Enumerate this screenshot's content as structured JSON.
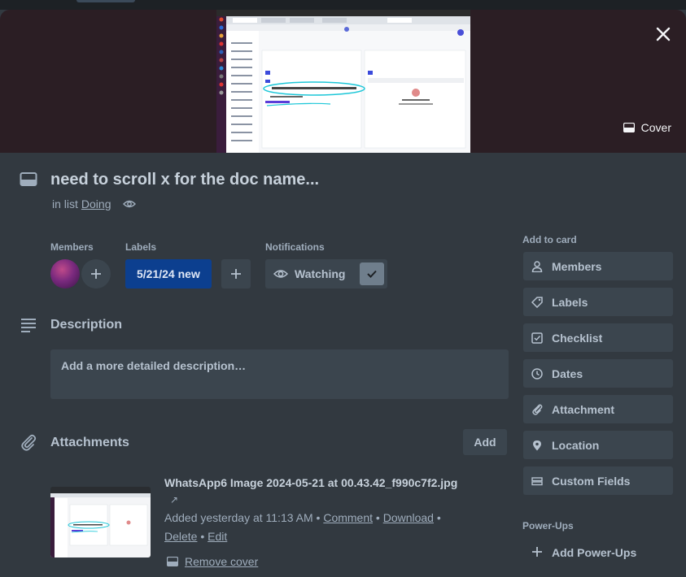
{
  "card": {
    "title": "need to scroll x for the doc name...",
    "in_list_prefix": "in list",
    "list_name": "Doing"
  },
  "cover": {
    "button_label": "Cover"
  },
  "members": {
    "label": "Members"
  },
  "labels": {
    "label": "Labels",
    "chip": "5/21/24 new",
    "chip_color": "#0c3f8f"
  },
  "notifications": {
    "label": "Notifications",
    "watch_label": "Watching"
  },
  "description": {
    "heading": "Description",
    "placeholder": "Add a more detailed description…"
  },
  "attachments": {
    "heading": "Attachments",
    "add_label": "Add",
    "item": {
      "name": "WhatsApp6 Image 2024-05-21 at 00.43.42_f990c7f2.jpg",
      "open_glyph": "↗",
      "added_text": "Added yesterday at 11:13 AM",
      "sep": "•",
      "comment": "Comment",
      "download": "Download",
      "delete": "Delete",
      "edit": "Edit",
      "remove_cover": "Remove cover"
    }
  },
  "sidebar": {
    "add_to_card": "Add to card",
    "buttons": [
      {
        "label": "Members",
        "icon": "person-icon"
      },
      {
        "label": "Labels",
        "icon": "tag-icon"
      },
      {
        "label": "Checklist",
        "icon": "checklist-icon"
      },
      {
        "label": "Dates",
        "icon": "clock-icon"
      },
      {
        "label": "Attachment",
        "icon": "paperclip-icon"
      },
      {
        "label": "Location",
        "icon": "pin-icon"
      },
      {
        "label": "Custom Fields",
        "icon": "custom-fields-icon"
      }
    ],
    "power_ups": "Power-Ups",
    "add_power_ups": "Add Power-Ups"
  },
  "colors": {
    "background": "#323940",
    "button": "#3b454e",
    "cover_bg": "#2b1e24",
    "accent": "#0c3f8f"
  }
}
